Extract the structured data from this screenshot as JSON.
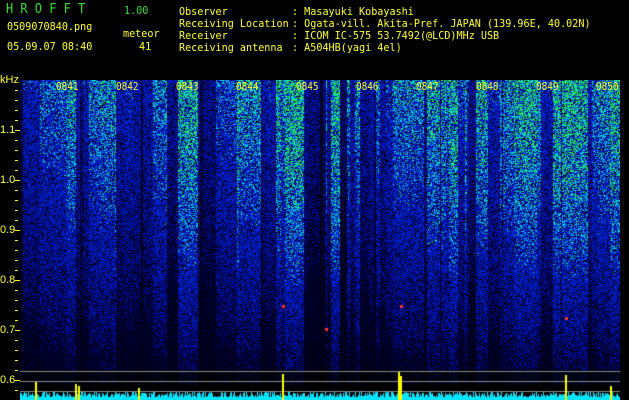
{
  "app": {
    "name": "H R O F F T",
    "version": "1.00"
  },
  "file": {
    "name": "0509070840.png",
    "datetime": "05.09.07 08:40"
  },
  "meteor": {
    "label": "meteor",
    "count": "41"
  },
  "info": [
    {
      "label": "Observer",
      "value": ": Masayuki Kobayashi"
    },
    {
      "label": "Receiving Location",
      "value": ": Ogata-vill. Akita-Pref. JAPAN (139.96E, 40.02N)"
    },
    {
      "label": "Receiver",
      "value": ": ICOM IC-575 53.7492(@LCD)MHz USB"
    },
    {
      "label": "Receiving antenna",
      "value": ": A504HB(yagi 4el)"
    }
  ],
  "y_axis": {
    "unit": "kHz",
    "ticks": [
      "1.1",
      "1.0",
      "0.9",
      "0.8",
      "0.7",
      "0.6"
    ]
  },
  "x_axis": {
    "ticks": [
      "0841",
      "0842",
      "0843",
      "0844",
      "0845",
      "0846",
      "0847",
      "0848",
      "0849",
      "0850"
    ]
  },
  "colors": {
    "text": "#ffff33",
    "title": "#33dd33",
    "baseline": "#00e5ff",
    "spike": "#ffff00"
  }
}
